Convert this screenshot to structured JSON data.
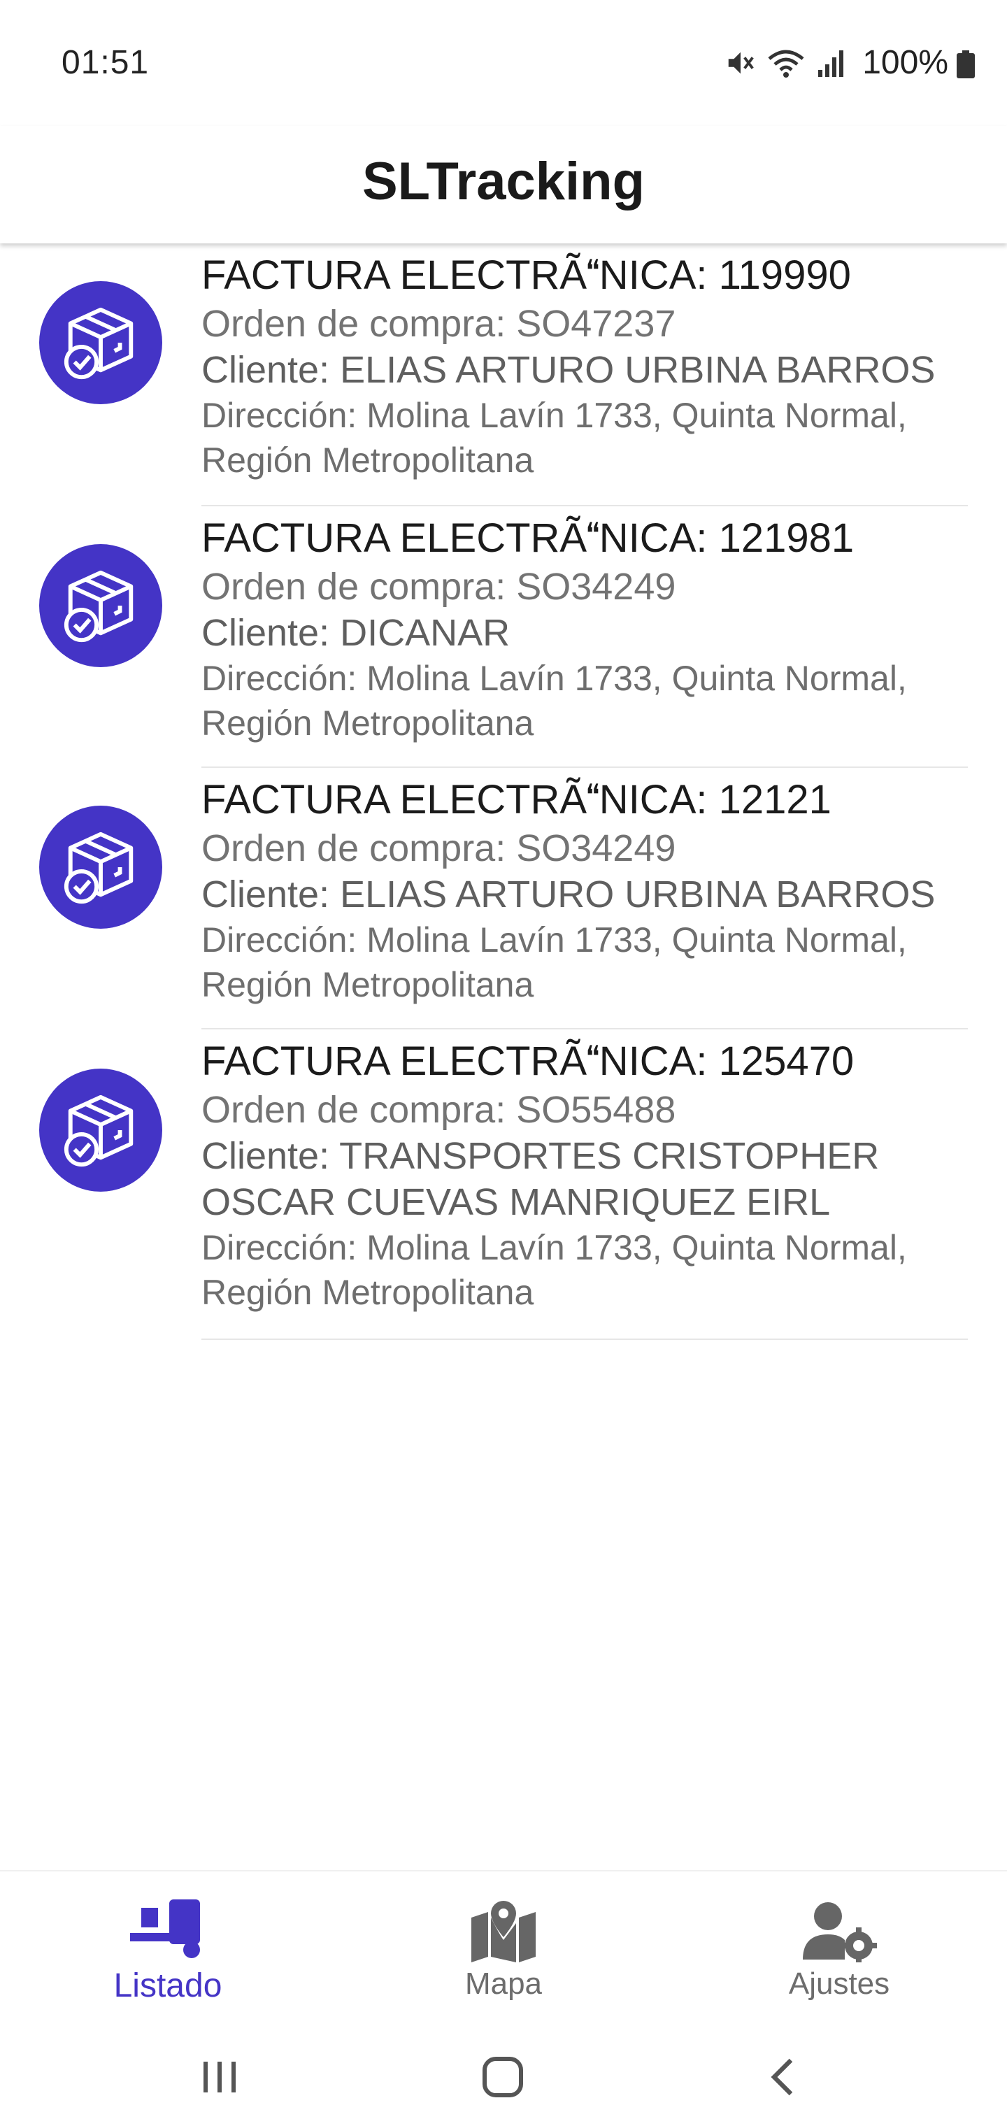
{
  "status_bar": {
    "time": "01:51",
    "battery_percent": "100%",
    "icons": [
      "mute-icon",
      "wifi-icon",
      "signal-icon",
      "battery-icon"
    ]
  },
  "header": {
    "title": "SLTracking"
  },
  "colors": {
    "accent": "#4434c6",
    "text_primary": "#1b1b1b",
    "text_secondary": "#737373"
  },
  "items": [
    {
      "title": "FACTURA ELECTRÃNICA: 119990",
      "order": "Orden de compra: SO47237",
      "client": "Cliente: ELIAS ARTURO URBINA BARROS",
      "address": "Dirección: Molina Lavín 1733, Quinta Normal, Región Metropolitana",
      "icon": "package-check-icon"
    },
    {
      "title": "FACTURA ELECTRÃNICA: 121981",
      "order": "Orden de compra: SO34249",
      "client": "Cliente: DICANAR",
      "address": "Dirección: Molina Lavín 1733, Quinta Normal, Región Metropolitana",
      "icon": "package-check-icon"
    },
    {
      "title": "FACTURA ELECTRÃNICA: 12121",
      "order": "Orden de compra: SO34249",
      "client": "Cliente: ELIAS ARTURO URBINA BARROS",
      "address": "Dirección: Molina Lavín 1733, Quinta Normal, Región Metropolitana",
      "icon": "package-check-icon"
    },
    {
      "title": "FACTURA ELECTRÃNICA: 125470",
      "order": "Orden de compra: SO55488",
      "client": "Cliente: TRANSPORTES CRISTOPHER OSCAR CUEVAS MANRIQUEZ EIRL",
      "address": "Dirección: Molina Lavín 1733, Quinta Normal, Región Metropolitana",
      "icon": "package-check-icon"
    }
  ],
  "bottom_nav": {
    "items": [
      {
        "label": "Listado",
        "icon": "dolly-icon",
        "active": true
      },
      {
        "label": "Mapa",
        "icon": "map-marker-icon",
        "active": false
      },
      {
        "label": "Ajustes",
        "icon": "user-settings-icon",
        "active": false
      }
    ]
  },
  "system_nav": {
    "buttons": [
      "recents-icon",
      "home-icon",
      "back-icon"
    ]
  }
}
